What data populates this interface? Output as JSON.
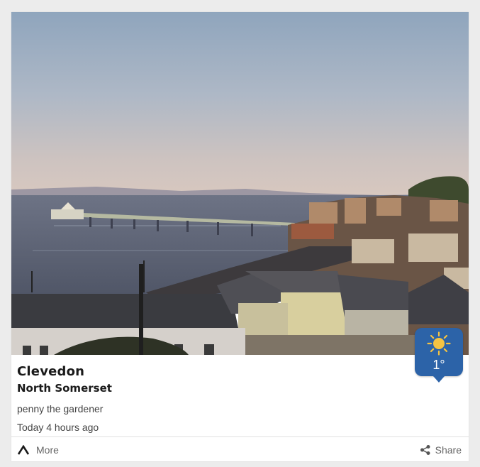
{
  "report": {
    "location": "Clevedon",
    "region": "North Somerset",
    "author": "penny the gardener",
    "posted": "Today 4 hours ago"
  },
  "weather": {
    "icon": "sun-icon",
    "temperature": "1°",
    "badge_color": "#2c63a8"
  },
  "footer": {
    "more_label": "More",
    "share_label": "Share"
  }
}
